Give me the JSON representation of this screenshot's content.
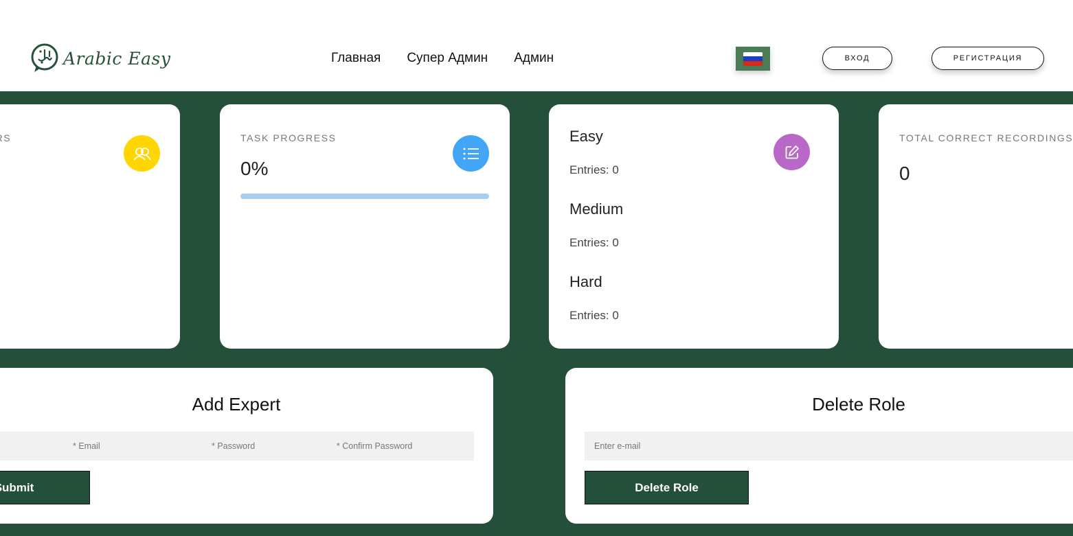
{
  "header": {
    "logo_text": "Arabic Easy",
    "nav": [
      "Главная",
      "Супер Админ",
      "Админ"
    ],
    "language_flag": "russia-flag",
    "login_label": "ВХОД",
    "register_label": "РЕГИСТРАЦИЯ"
  },
  "colors": {
    "brand_green": "#244f3b",
    "users_icon_bg": "#ffd600",
    "task_icon_bg": "#42a5f5",
    "levels_icon_bg": "#ba68c8",
    "progress_bar": "#a9cdef"
  },
  "stats": {
    "users": {
      "label": "USERS",
      "icon": "users-icon"
    },
    "task_progress": {
      "label": "TASK PROGRESS",
      "value": "0%",
      "progress_percent": 0,
      "icon": "list-icon"
    },
    "levels": {
      "icon": "edit-icon",
      "items": [
        {
          "title": "Easy",
          "entries_label": "Entries:",
          "entries_value": "0"
        },
        {
          "title": "Medium",
          "entries_label": "Entries:",
          "entries_value": "0"
        },
        {
          "title": "Hard",
          "entries_label": "Entries:",
          "entries_value": "0"
        }
      ]
    },
    "recordings": {
      "label": "TOTAL CORRECT RECORDINGS",
      "value": "0"
    }
  },
  "add_expert": {
    "title": "Add Expert",
    "email_placeholder": "* Email",
    "password_placeholder": "* Password",
    "confirm_placeholder": "* Confirm Password",
    "submit_label": "Submit"
  },
  "delete_role": {
    "title": "Delete Role",
    "email_placeholder": "Enter e-mail",
    "button_label": "Delete Role"
  }
}
